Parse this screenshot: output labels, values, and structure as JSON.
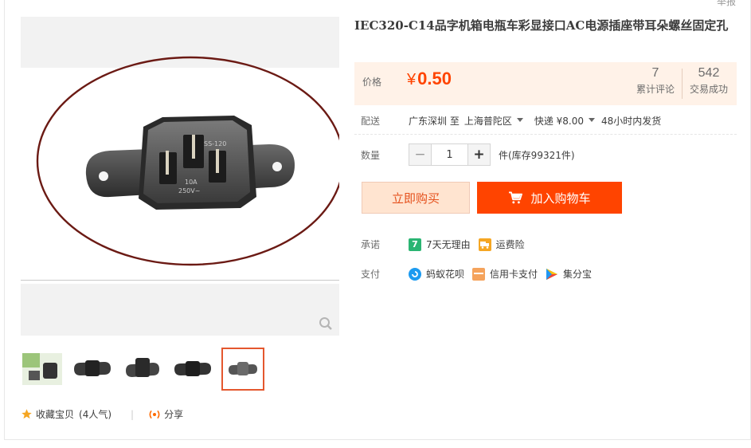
{
  "header": {
    "report_label": "举报"
  },
  "product": {
    "title": "IEC320-C14品字机箱电瓶车彩显接口AC电源插座带耳朵螺丝固定孔",
    "price_label": "价格",
    "currency": "¥",
    "price": "0.50",
    "reviews_count": "7",
    "reviews_label": "累计评论",
    "sales_count": "542",
    "sales_label": "交易成功"
  },
  "delivery": {
    "label": "配送",
    "from": "广东深圳 至",
    "to": "上海普陀区",
    "shipping": "快递 ¥8.00",
    "dispatch": "48小时内发货"
  },
  "quantity": {
    "label": "数量",
    "minus": "−",
    "value": "1",
    "plus": "+",
    "stock": "件(库存99321件)"
  },
  "actions": {
    "buy_now": "立即购买",
    "add_to_cart": "加入购物车"
  },
  "promise": {
    "label": "承诺",
    "items": [
      {
        "icon": "seven-day-return-icon",
        "badge": "7",
        "text": "7天无理由",
        "color": "#2bb573"
      },
      {
        "icon": "shipping-insurance-icon",
        "badge": "",
        "text": "运费险",
        "color": "#f5a623"
      }
    ]
  },
  "payment": {
    "label": "支付",
    "items": [
      {
        "icon": "huabei-icon",
        "text": "蚂蚁花呗",
        "color": "#1d9bf0"
      },
      {
        "icon": "credit-card-icon",
        "text": "信用卡支付",
        "color": "#f5a35c"
      },
      {
        "icon": "jifenbao-icon",
        "text": "集分宝",
        "color": "#4caf50"
      }
    ]
  },
  "gallery": {
    "selected_thumbnail": 5,
    "thumbnail_count": 5
  },
  "social": {
    "favorite": "收藏宝贝",
    "popularity": "(4人气)",
    "share": "分享"
  },
  "colors": {
    "accent": "#ff4400",
    "price": "#ff4400",
    "price_bg": "#fff2e8"
  }
}
